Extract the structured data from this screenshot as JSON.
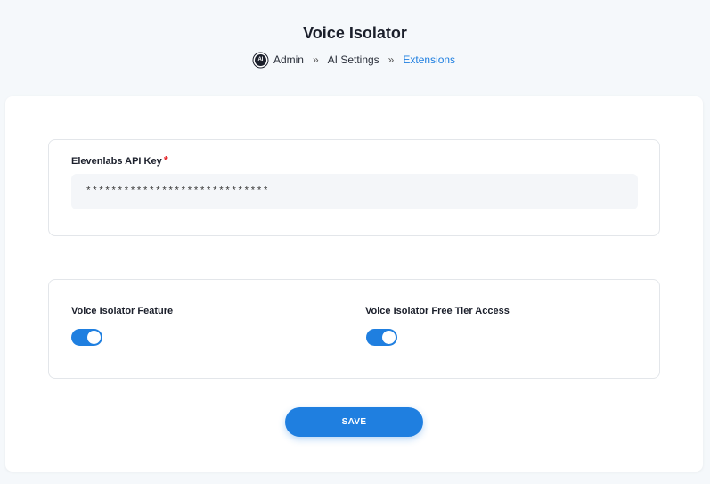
{
  "page": {
    "title": "Voice Isolator"
  },
  "breadcrumb": {
    "icon": "ai-chip-icon",
    "icon_text": "AI",
    "separator": "»",
    "items": [
      {
        "label": "Admin"
      },
      {
        "label": "AI Settings"
      },
      {
        "label": "Extensions"
      }
    ]
  },
  "api_section": {
    "label": "Elevenlabs API Key",
    "required_marker": "*",
    "value": "*****************************"
  },
  "toggles": {
    "feature": {
      "label": "Voice Isolator Feature",
      "enabled": true
    },
    "free_tier": {
      "label": "Voice Isolator Free Tier Access",
      "enabled": true
    }
  },
  "actions": {
    "save_label": "SAVE"
  },
  "colors": {
    "accent": "#1f7fe0",
    "required": "#e5262a",
    "background": "#f5f8fb"
  }
}
